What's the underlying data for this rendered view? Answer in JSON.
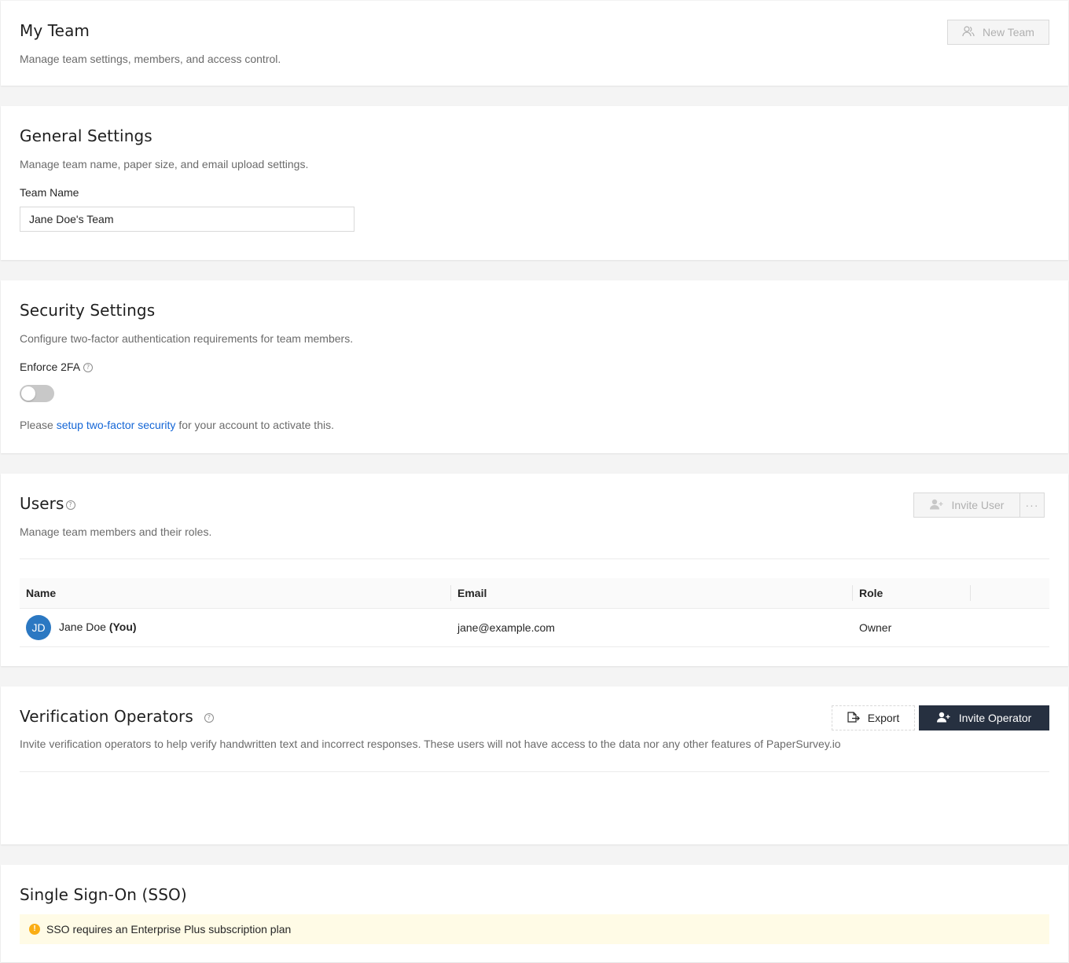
{
  "header": {
    "title": "My Team",
    "subtitle": "Manage team settings, members, and access control.",
    "new_team_label": "New Team"
  },
  "general": {
    "title": "General Settings",
    "subtitle": "Manage team name, paper size, and email upload settings.",
    "team_name_label": "Team Name",
    "team_name_value": "Jane Doe's Team"
  },
  "security": {
    "title": "Security Settings",
    "subtitle": "Configure two-factor authentication requirements for team members.",
    "enforce_label": "Enforce 2FA",
    "enforce_enabled": false,
    "note_prefix": "Please ",
    "note_link": "setup two-factor security",
    "note_suffix": " for your account to activate this."
  },
  "users": {
    "title": "Users",
    "subtitle": "Manage team members and their roles.",
    "invite_label": "Invite User",
    "more_label": "···",
    "columns": [
      "Name",
      "Email",
      "Role"
    ],
    "rows": [
      {
        "initials": "JD",
        "name": "Jane Doe",
        "you": "(You)",
        "email": "jane@example.com",
        "role": "Owner"
      }
    ]
  },
  "operators": {
    "title": "Verification Operators",
    "subtitle": "Invite verification operators to help verify handwritten text and incorrect responses. These users will not have access to the data nor any other features of PaperSurvey.io",
    "export_label": "Export",
    "invite_label": "Invite Operator"
  },
  "sso": {
    "title": "Single Sign-On (SSO)",
    "alert": "SSO requires an Enterprise Plus subscription plan"
  },
  "colors": {
    "primary": "#263040",
    "link": "#1466d6",
    "avatar": "#2b78c2",
    "warning": "#faad14",
    "warning_bg": "#fffbe6"
  }
}
